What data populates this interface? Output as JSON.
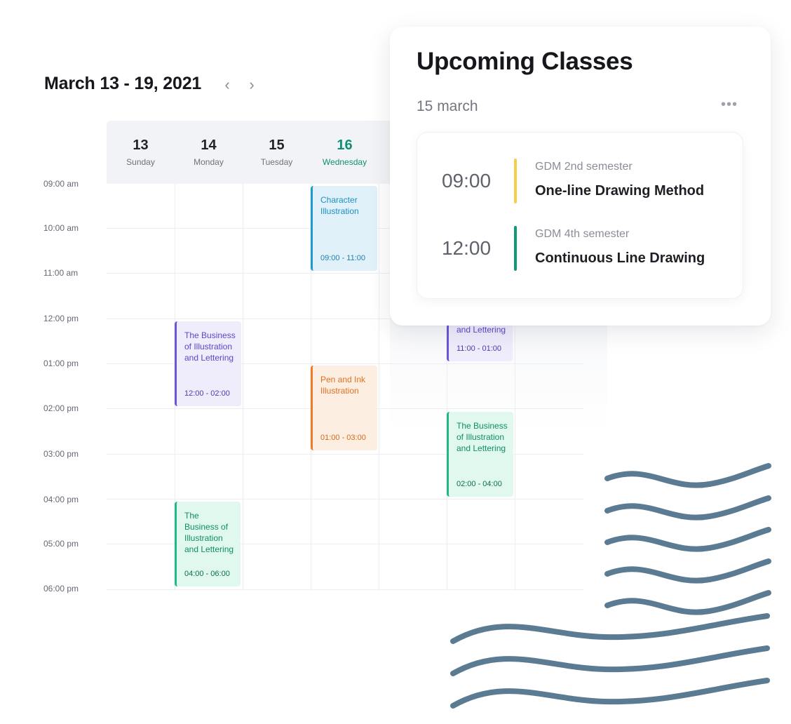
{
  "calendar": {
    "week_title": "March 13 - 19, 2021",
    "prev_icon": "‹",
    "next_icon": "›",
    "days": [
      {
        "num": "13",
        "name": "Sunday",
        "active": false
      },
      {
        "num": "14",
        "name": "Monday",
        "active": false
      },
      {
        "num": "15",
        "name": "Tuesday",
        "active": false
      },
      {
        "num": "16",
        "name": "Wednesday",
        "active": true
      }
    ],
    "hours": [
      "09:00 am",
      "10:00 am",
      "11:00 am",
      "12:00 pm",
      "01:00 pm",
      "02:00 pm",
      "03:00 pm",
      "04:00 pm",
      "05:00 pm",
      "06:00 pm"
    ],
    "events": [
      {
        "title": "Character Illustration",
        "time": "09:00 - 11:00",
        "color": "blue"
      },
      {
        "title": "The Business of Illustration and Lettering",
        "time": "12:00 - 02:00",
        "color": "purple"
      },
      {
        "title": "Pen and Ink Illustration",
        "time": "01:00 - 03:00",
        "color": "orange"
      },
      {
        "title": "and Lettering",
        "time": "11:00 - 01:00",
        "color": "purple"
      },
      {
        "title": "The Business of Illustration and Lettering",
        "time": "02:00 - 04:00",
        "color": "green"
      },
      {
        "title": "The Business of Illustration and Lettering",
        "time": "04:00 - 06:00",
        "color": "green"
      }
    ]
  },
  "upcoming": {
    "title": "Upcoming Classes",
    "date": "15 march",
    "more_icon": "•••",
    "classes": [
      {
        "time": "09:00",
        "group": "GDM 2nd semester",
        "name": "One-line Drawing Method",
        "accent": "#f5cf4a"
      },
      {
        "time": "12:00",
        "group": "GDM 4th semester",
        "name": "Continuous Line Drawing",
        "accent": "#119a76"
      }
    ]
  },
  "colors": {
    "wave": "#5b7b93",
    "accent_green": "#0f8f73"
  }
}
